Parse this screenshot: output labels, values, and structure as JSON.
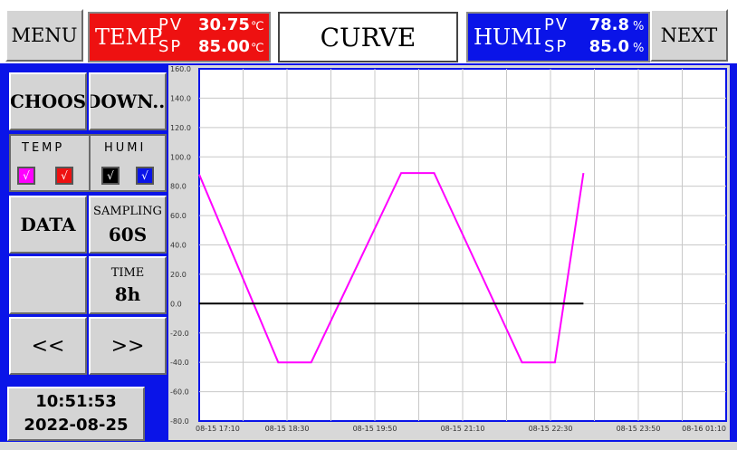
{
  "header": {
    "menu_label": "MENU",
    "next_label": "NEXT",
    "title": "CURVE",
    "temp": {
      "label": "TEMP",
      "pv_label": "PV",
      "pv_value": "30.75",
      "sp_label": "SP",
      "sp_value": "85.00",
      "unit": "℃",
      "color": "#ee1111"
    },
    "humi": {
      "label": "HUMI",
      "pv_label": "PV",
      "pv_value": "78.8",
      "sp_label": "SP",
      "sp_value": "85.0",
      "unit": "%",
      "color": "#0a14e8"
    }
  },
  "sidebar": {
    "choose_label": "CHOOS",
    "down_label": "DOWN...",
    "legend": {
      "temp_label": "TEMP",
      "humi_label": "HUMI",
      "temp_pv_color": "#ff00ff",
      "temp_sp_color": "#ee1111",
      "humi_pv_color": "#000000",
      "humi_sp_color": "#0a14e8",
      "check_glyph": "√"
    },
    "data_label": "DATA",
    "sampling_label": "SAMPLING",
    "sampling_value": "60S",
    "time_label": "TIME",
    "time_value": "8h",
    "prev_label": "<<",
    "next_label": ">>"
  },
  "clock": {
    "time": "10:51:53",
    "date": "2022-08-25"
  },
  "chart_data": {
    "type": "line",
    "ylim": [
      -80,
      160
    ],
    "y_ticks": [
      "160.0",
      "140.0",
      "120.0",
      "100.0",
      "80.0",
      "60.0",
      "40.0",
      "20.0",
      "0.0",
      "-20.0",
      "-40.0",
      "-60.0",
      "-80.0"
    ],
    "x_ticks": [
      "08-15 17:10",
      "08-15 18:30",
      "08-15 19:50",
      "08-15 21:10",
      "08-15 22:30",
      "08-15 23:50",
      "08-16 01:10"
    ],
    "grid": true,
    "series": [
      {
        "color": "#ff00ff",
        "points": [
          [
            "08-15 17:10",
            88
          ],
          [
            "08-15 18:22",
            -40
          ],
          [
            "08-15 18:52",
            -40
          ],
          [
            "08-15 20:14",
            89
          ],
          [
            "08-15 20:44",
            89
          ],
          [
            "08-15 22:04",
            -40
          ],
          [
            "08-15 22:34",
            -40
          ],
          [
            "08-15 23:00",
            89
          ]
        ]
      },
      {
        "color": "#000000",
        "points": [
          [
            "08-15 17:10",
            0
          ],
          [
            "08-15 23:00",
            0
          ]
        ]
      }
    ]
  }
}
